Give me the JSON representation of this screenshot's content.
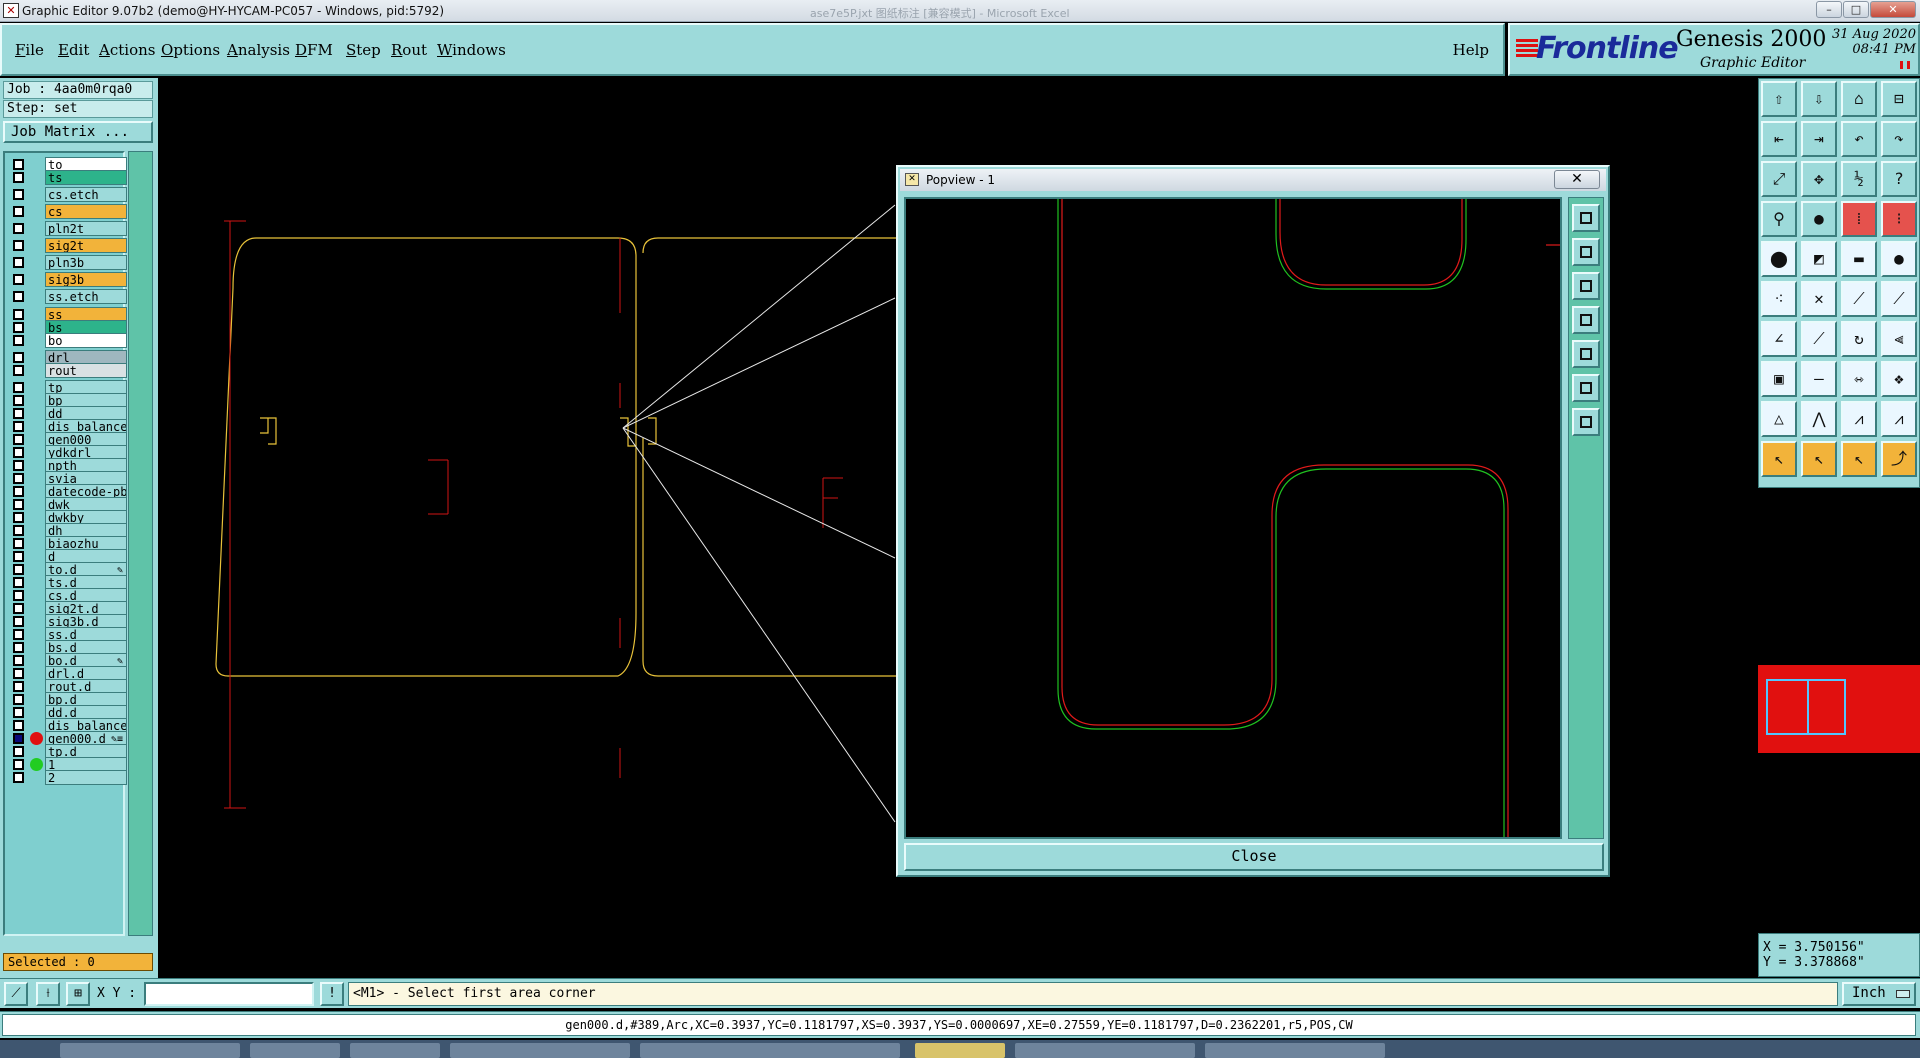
{
  "window": {
    "title": "Graphic Editor 9.07b2 (demo@HY-HYCAM-PC057 - Windows, pid:5792)",
    "background_title": "ase7e5P.jxt 图纸标注 [兼容模式] - Microsoft Excel",
    "minimize": "–",
    "maximize": "□",
    "close": "✕"
  },
  "menu": {
    "items": [
      "File",
      "Edit",
      "Actions",
      "Options",
      "Analysis",
      "DFM",
      "Step",
      "Rout",
      "Windows"
    ],
    "help": "Help"
  },
  "brand": {
    "logo": "Frontline",
    "product": "Genesis 2000",
    "subtitle": "Graphic Editor",
    "date": "31 Aug 2020",
    "time": "08:41 PM"
  },
  "job": {
    "job_line": "Job : 4aa0m0rqa0",
    "step_line": "Step: set",
    "matrix_button": "Job Matrix ..."
  },
  "layers": [
    {
      "name": "to",
      "color": "#ffffff",
      "mark": ""
    },
    {
      "name": "ts",
      "color": "#2db38b",
      "mark": ""
    },
    {
      "name": "cs.etch",
      "color": "#9ddada",
      "mark": ""
    },
    {
      "name": "cs",
      "color": "#f2b33a",
      "mark": ""
    },
    {
      "name": "pln2t",
      "color": "#9ddada",
      "mark": ""
    },
    {
      "name": "sig2t",
      "color": "#f2b33a",
      "mark": ""
    },
    {
      "name": "pln3b",
      "color": "#9ddada",
      "mark": ""
    },
    {
      "name": "sig3b",
      "color": "#f2b33a",
      "mark": ""
    },
    {
      "name": "ss.etch",
      "color": "#9ddada",
      "mark": ""
    },
    {
      "name": "ss",
      "color": "#f2b33a",
      "mark": ""
    },
    {
      "name": "bs",
      "color": "#2db38b",
      "mark": ""
    },
    {
      "name": "bo",
      "color": "#ffffff",
      "mark": ""
    },
    {
      "name": "drl",
      "color": "#9fb7bf",
      "mark": ""
    },
    {
      "name": "rout",
      "color": "#d9e1e3",
      "mark": ""
    },
    {
      "name": "tp",
      "color": "#9ddada",
      "mark": ""
    },
    {
      "name": "bp",
      "color": "#9ddada",
      "mark": ""
    },
    {
      "name": "dd",
      "color": "#9ddada",
      "mark": ""
    },
    {
      "name": "dis_balance",
      "color": "#9ddada",
      "mark": ""
    },
    {
      "name": "gen000",
      "color": "#9ddada",
      "mark": ""
    },
    {
      "name": "ydkdrl",
      "color": "#9ddada",
      "mark": ""
    },
    {
      "name": "npth",
      "color": "#9ddada",
      "mark": ""
    },
    {
      "name": "svia",
      "color": "#9ddada",
      "mark": ""
    },
    {
      "name": "datecode-pb",
      "color": "#9ddada",
      "mark": ""
    },
    {
      "name": "dwk",
      "color": "#9ddada",
      "mark": ""
    },
    {
      "name": "dwkby",
      "color": "#9ddada",
      "mark": ""
    },
    {
      "name": "dh",
      "color": "#9ddada",
      "mark": ""
    },
    {
      "name": "biaozhu",
      "color": "#9ddada",
      "mark": ""
    },
    {
      "name": "d",
      "color": "#9ddada",
      "mark": ""
    },
    {
      "name": "to.d",
      "color": "#9ddada",
      "mark": "✎"
    },
    {
      "name": "ts.d",
      "color": "#9ddada",
      "mark": ""
    },
    {
      "name": "cs.d",
      "color": "#9ddada",
      "mark": ""
    },
    {
      "name": "sig2t.d",
      "color": "#9ddada",
      "mark": ""
    },
    {
      "name": "sig3b.d",
      "color": "#9ddada",
      "mark": ""
    },
    {
      "name": "ss.d",
      "color": "#9ddada",
      "mark": ""
    },
    {
      "name": "bs.d",
      "color": "#9ddada",
      "mark": ""
    },
    {
      "name": "bo.d",
      "color": "#9ddada",
      "mark": "✎"
    },
    {
      "name": "drl.d",
      "color": "#9ddada",
      "mark": ""
    },
    {
      "name": "rout.d",
      "color": "#9ddada",
      "mark": ""
    },
    {
      "name": "bp.d",
      "color": "#9ddada",
      "mark": ""
    },
    {
      "name": "dd.d",
      "color": "#9ddada",
      "mark": ""
    },
    {
      "name": "dis_balance",
      "color": "#9ddada",
      "mark": ""
    },
    {
      "name": "gen000.d",
      "color": "#9ddada",
      "mark": "✎≡",
      "work": true,
      "dot": "#e01010"
    },
    {
      "name": "tp.d",
      "color": "#9ddada",
      "mark": ""
    },
    {
      "name": "1",
      "color": "#9ddada",
      "mark": "",
      "dot": "#22cc22"
    },
    {
      "name": "2",
      "color": "#9ddada",
      "mark": ""
    }
  ],
  "selected": "Selected : 0",
  "popview": {
    "title": "Popview - 1",
    "close_x": "✕",
    "close_button": "Close"
  },
  "coords": {
    "x": "X = 3.750156\"",
    "y": "Y = 3.378868\""
  },
  "bottom": {
    "xy_label": "X Y :",
    "xy_value": "",
    "prompt": "<M1> - Select first area corner",
    "unit": "Inch",
    "status": "gen000.d,#389,Arc,XC=0.3937,YC=0.1181797,XS=0.3937,YS=0.0000697,XE=0.27559,YE=0.1181797,D=0.2362201,r5,POS,CW"
  },
  "colors": {
    "panel": "#9ddada",
    "profile": "#e8c23a",
    "drawing": "#d11414",
    "highlight": "#f2b33a"
  }
}
